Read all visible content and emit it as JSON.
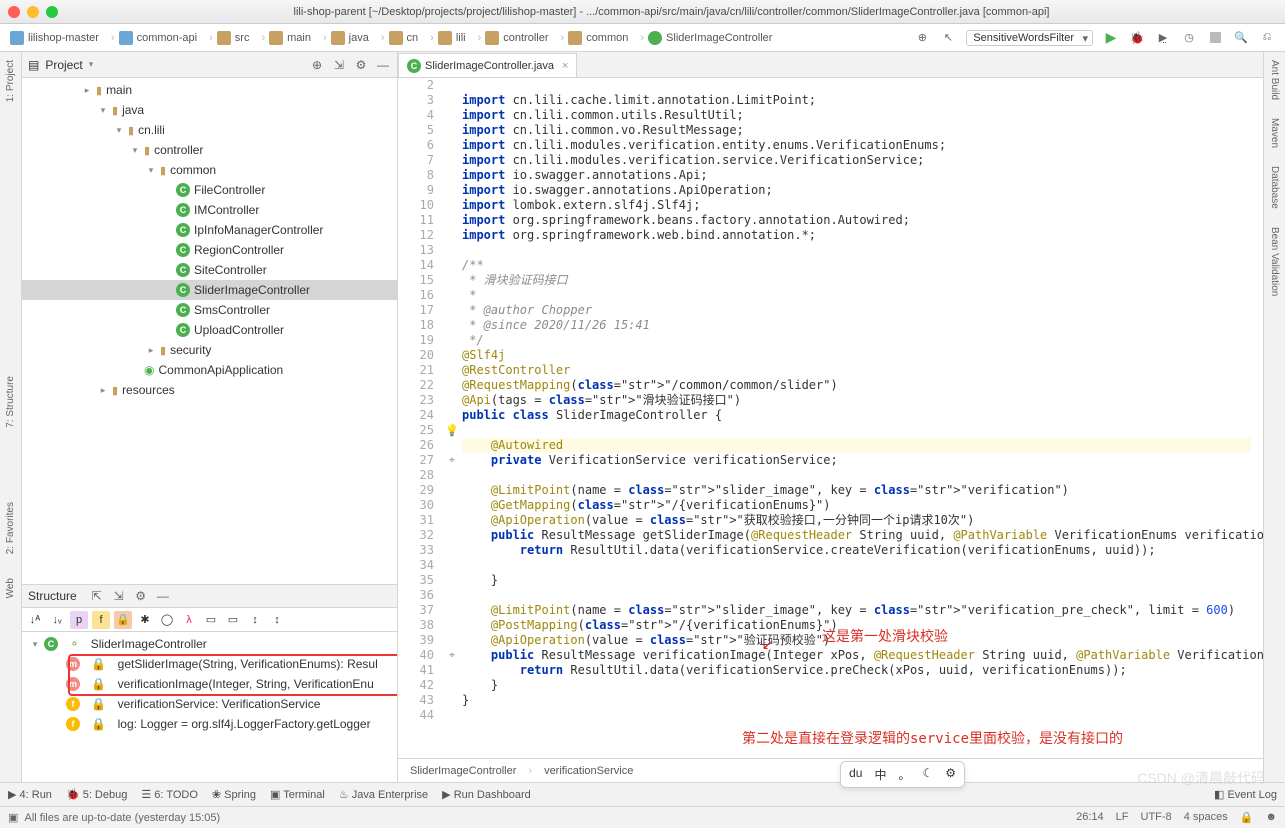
{
  "window": {
    "title": "lili-shop-parent [~/Desktop/projects/project/lilishop-master] - .../common-api/src/main/java/cn/lili/controller/common/SliderImageController.java [common-api]"
  },
  "breadcrumbs": [
    "lilishop-master",
    "common-api",
    "src",
    "main",
    "java",
    "cn",
    "lili",
    "controller",
    "common",
    "SliderImageController"
  ],
  "runconfig": "SensitiveWordsFilter",
  "project": {
    "label": "Project",
    "nodes": [
      {
        "indent": 3,
        "arrow": "▸",
        "type": "dir",
        "label": "main"
      },
      {
        "indent": 4,
        "arrow": "▾",
        "type": "dir",
        "label": "java"
      },
      {
        "indent": 5,
        "arrow": "▾",
        "type": "dir",
        "label": "cn.lili"
      },
      {
        "indent": 6,
        "arrow": "▾",
        "type": "dir",
        "label": "controller"
      },
      {
        "indent": 7,
        "arrow": "▾",
        "type": "dir",
        "label": "common"
      },
      {
        "indent": 8,
        "arrow": "",
        "type": "class",
        "label": "FileController"
      },
      {
        "indent": 8,
        "arrow": "",
        "type": "class",
        "label": "IMController"
      },
      {
        "indent": 8,
        "arrow": "",
        "type": "class",
        "label": "IpInfoManagerController"
      },
      {
        "indent": 8,
        "arrow": "",
        "type": "class",
        "label": "RegionController"
      },
      {
        "indent": 8,
        "arrow": "",
        "type": "class",
        "label": "SiteController"
      },
      {
        "indent": 8,
        "arrow": "",
        "type": "class",
        "label": "SliderImageController",
        "sel": true
      },
      {
        "indent": 8,
        "arrow": "",
        "type": "class",
        "label": "SmsController"
      },
      {
        "indent": 8,
        "arrow": "",
        "type": "class",
        "label": "UploadController"
      },
      {
        "indent": 7,
        "arrow": "▸",
        "type": "dir",
        "label": "security"
      },
      {
        "indent": 6,
        "arrow": "",
        "type": "app",
        "label": "CommonApiApplication"
      },
      {
        "indent": 4,
        "arrow": "▸",
        "type": "dir",
        "label": "resources"
      }
    ]
  },
  "structure": {
    "label": "Structure",
    "root": "SliderImageController",
    "items": [
      {
        "icon": "m",
        "color": "#f28b82",
        "label": "getSliderImage(String, VerificationEnums): Resul"
      },
      {
        "icon": "m",
        "color": "#f28b82",
        "label": "verificationImage(Integer, String, VerificationEnu"
      },
      {
        "icon": "f",
        "color": "#fbbc04",
        "label": "verificationService: VerificationService"
      },
      {
        "icon": "f",
        "color": "#fbbc04",
        "label": "log: Logger = org.slf4j.LoggerFactory.getLogger"
      }
    ]
  },
  "editor": {
    "tab": "SliderImageController.java",
    "startLine": 2,
    "lines": [
      "",
      "import cn.lili.cache.limit.annotation.LimitPoint;",
      "import cn.lili.common.utils.ResultUtil;",
      "import cn.lili.common.vo.ResultMessage;",
      "import cn.lili.modules.verification.entity.enums.VerificationEnums;",
      "import cn.lili.modules.verification.service.VerificationService;",
      "import io.swagger.annotations.Api;",
      "import io.swagger.annotations.ApiOperation;",
      "import lombok.extern.slf4j.Slf4j;",
      "import org.springframework.beans.factory.annotation.Autowired;",
      "import org.springframework.web.bind.annotation.*;",
      "",
      "/**",
      " * 滑块验证码接口",
      " *",
      " * @author Chopper",
      " * @since 2020/11/26 15:41",
      " */",
      "@Slf4j",
      "@RestController",
      "@RequestMapping(\"/common/common/slider\")",
      "@Api(tags = \"滑块验证码接口\")",
      "public class SliderImageController {",
      "",
      "    @Autowired",
      "    private VerificationService verificationService;",
      "",
      "    @LimitPoint(name = \"slider_image\", key = \"verification\")",
      "    @GetMapping(\"/{verificationEnums}\")",
      "    @ApiOperation(value = \"获取校验接口,一分钟同一个ip请求10次\")",
      "    public ResultMessage getSliderImage(@RequestHeader String uuid, @PathVariable VerificationEnums verificationE",
      "        return ResultUtil.data(verificationService.createVerification(verificationEnums, uuid));",
      "",
      "    }",
      "",
      "    @LimitPoint(name = \"slider_image\", key = \"verification_pre_check\", limit = 600)",
      "    @PostMapping(\"/{verificationEnums}\")",
      "    @ApiOperation(value = \"验证码预校验\")",
      "    public ResultMessage verificationImage(Integer xPos, @RequestHeader String uuid, @PathVariable VerificationEn",
      "        return ResultUtil.data(verificationService.preCheck(xPos, uuid, verificationEnums));",
      "    }",
      "}",
      ""
    ],
    "highlightLine": 26,
    "breadcrumb": [
      "SliderImageController",
      "verificationService"
    ]
  },
  "annotations": {
    "a1": "这是第一处滑块校验",
    "a2": "第二处是直接在登录逻辑的service里面校验，是没有接口的"
  },
  "bottombar": [
    "4: Run",
    "5: Debug",
    "6: TODO",
    "Spring",
    "Terminal",
    "Java Enterprise",
    "Run Dashboard"
  ],
  "eventlog": "Event Log",
  "status": {
    "msg": "All files are up-to-date (yesterday 15:05)",
    "pos": "26:14",
    "lf": "LF",
    "enc": "UTF-8",
    "indent": "4 spaces"
  },
  "floatbar": [
    "du",
    "中",
    "。",
    "☾",
    "⚙"
  ],
  "lefttabs": [
    "1: Project",
    "7: Structure",
    "2: Favorites",
    "Web"
  ],
  "righttabs": [
    "Ant Build",
    "Maven",
    "Database",
    "Bean Validation"
  ],
  "watermark": "CSDN @清晨敲代码"
}
